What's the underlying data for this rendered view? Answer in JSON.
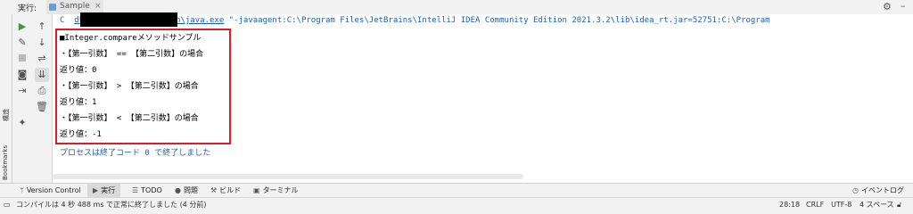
{
  "header": {
    "run_label": "実行:",
    "tab_label": "Sample",
    "tab_close": "×"
  },
  "left_stripe": {
    "structure_label": "構造",
    "bookmarks_label": "Bookmarks"
  },
  "console": {
    "command_prefix": "C",
    "command_path": "dks\\openjdk-17.0.2\\bin\\java.exe",
    "command_rest": " \"-javaagent:C:\\Program Files\\JetBrains\\IntelliJ IDEA Community Edition 2021.3.2\\lib\\idea_rt.jar=52751:C:\\Program",
    "output_lines": [
      "■Integer.compareメソッドサンプル",
      "・【第一引数】 == 【第二引数】の場合",
      "返り値：0",
      "・【第一引数】 > 【第二引数】の場合",
      "返り値：1",
      "・【第一引数】 < 【第二引数】の場合",
      "返り値：-1"
    ],
    "exit_message": "プロセスは終了コード 0 で終了しました"
  },
  "bottom_tabs": {
    "version_control": "Version Control",
    "run": "実行",
    "todo": "TODO",
    "problems": "問題",
    "build": "ビルド",
    "terminal": "ターミナル",
    "event_log": "イベントログ"
  },
  "status_bar": {
    "message": "コンパイルは 4 秒 488 ms で正常に終了しました (4 分前)",
    "position": "28:18",
    "line_sep": "CRLF",
    "encoding": "UTF-8",
    "indent": "4 スペース"
  },
  "colors": {
    "accent": "#4a88c7",
    "highlight_box": "#e0192b",
    "link_blue": "#1a5fb4"
  }
}
